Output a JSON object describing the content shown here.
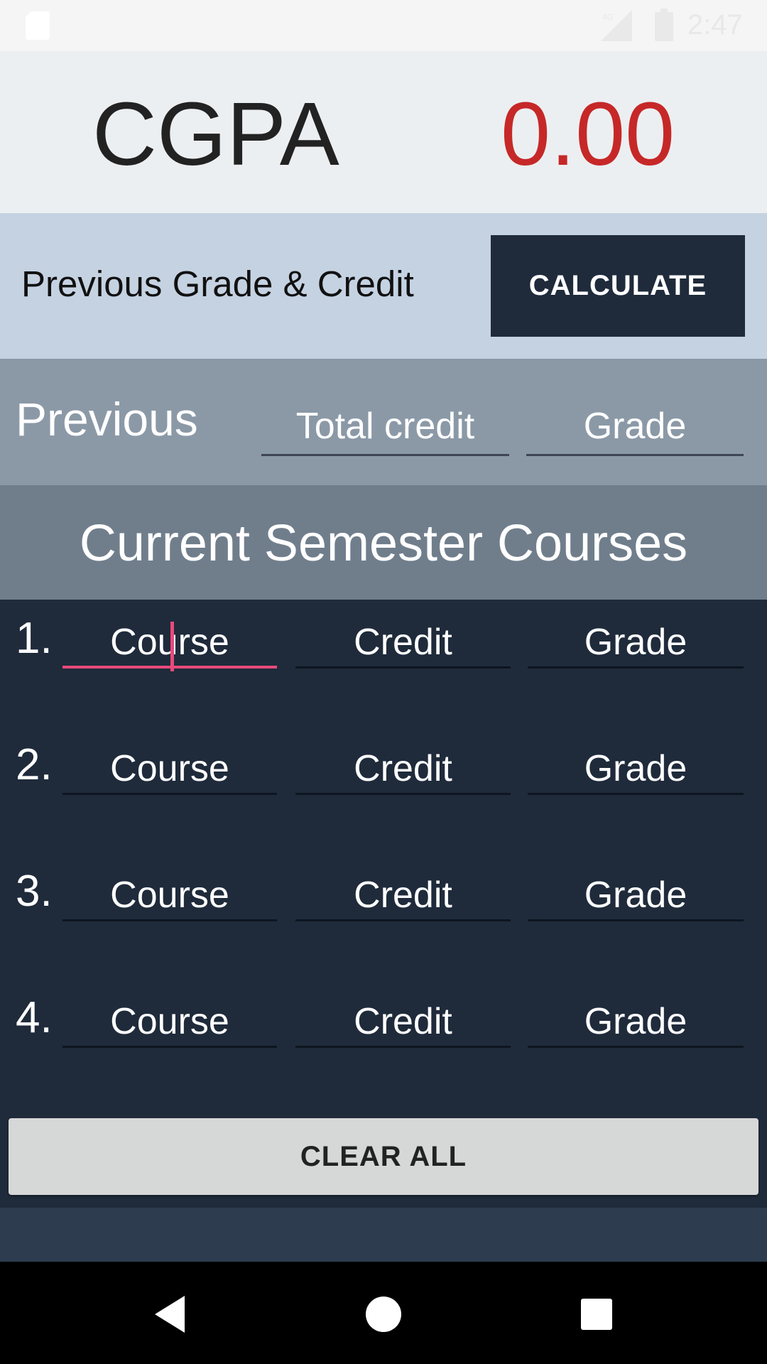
{
  "status_bar": {
    "time": "2:47",
    "network_label": "4G"
  },
  "header": {
    "title": "CGPA",
    "value": "0.00",
    "value_color": "#c62828"
  },
  "previous_section": {
    "title": "Previous Grade & Credit",
    "calculate_label": "CALCULATE"
  },
  "previous_inputs": {
    "label": "Previous",
    "credit_placeholder": "Total credit",
    "grade_placeholder": "Grade"
  },
  "current": {
    "title": "Current Semester Courses",
    "rows": [
      {
        "num": "1.",
        "course": "Course",
        "credit": "Credit",
        "grade": "Grade"
      },
      {
        "num": "2.",
        "course": "Course",
        "credit": "Credit",
        "grade": "Grade"
      },
      {
        "num": "3.",
        "course": "Course",
        "credit": "Credit",
        "grade": "Grade"
      },
      {
        "num": "4.",
        "course": "Course",
        "credit": "Credit",
        "grade": "Grade"
      }
    ]
  },
  "clear_label": "CLEAR ALL",
  "colors": {
    "accent": "#e84a7c",
    "dark_panel": "#1f2b3b",
    "header_bg": "#eceff1"
  },
  "nav": {
    "back_icon": "back-triangle",
    "home_icon": "home-circle",
    "recent_icon": "recents-square"
  }
}
